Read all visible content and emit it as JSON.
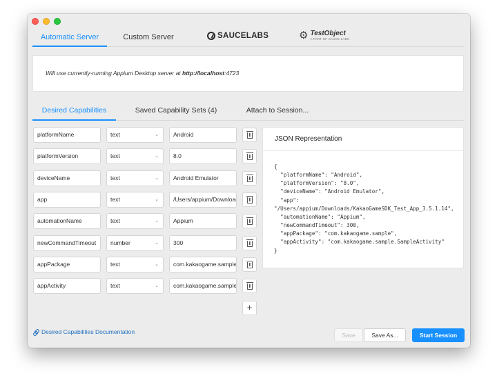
{
  "server_tabs": {
    "automatic": "Automatic Server",
    "custom": "Custom Server",
    "saucelabs": "SAUCELABS",
    "testobject": "TestObject",
    "testobject_sub": "A PART OF SAUCE LABS"
  },
  "server_message": {
    "prefix": "Will use currently-running Appium Desktop server at ",
    "url": "http://localhost",
    "port": ":4723"
  },
  "cap_tabs": {
    "desired": "Desired Capabilities",
    "saved": "Saved Capability Sets (4)",
    "attach": "Attach to Session..."
  },
  "capabilities": [
    {
      "name": "platformName",
      "type": "text",
      "value": "Android"
    },
    {
      "name": "platformVersion",
      "type": "text",
      "value": "8.0"
    },
    {
      "name": "deviceName",
      "type": "text",
      "value": "Android Emulator"
    },
    {
      "name": "app",
      "type": "text",
      "value": "/Users/appium/Downloads/KakaoGameSDK_Test_App_3.5.1.14"
    },
    {
      "name": "automationName",
      "type": "text",
      "value": "Appium"
    },
    {
      "name": "newCommandTimeout",
      "type": "number",
      "value": "300"
    },
    {
      "name": "appPackage",
      "type": "text",
      "value": "com.kakaogame.sample"
    },
    {
      "name": "appActivity",
      "type": "text",
      "value": "com.kakaogame.sample.SampleActivity"
    }
  ],
  "json_panel": {
    "title": "JSON Representation",
    "body": "{\n  \"platformName\": \"Android\",\n  \"platformVersion\": \"8.0\",\n  \"deviceName\": \"Android Emulator\",\n  \"app\":\n\"/Users/appium/Downloads/KakaoGameSDK_Test_App_3.5.1.14\",\n  \"automationName\": \"Appium\",\n  \"newCommandTimeout\": 300,\n  \"appPackage\": \"com.kakaogame.sample\",\n  \"appActivity\": \"com.kakaogame.sample.SampleActivity\"\n}"
  },
  "footer": {
    "docs_link": "Desired Capabilities Documentation",
    "save": "Save",
    "save_as": "Save As...",
    "start": "Start Session"
  },
  "icons": {
    "add": "+",
    "chevron": "⌄"
  },
  "colors": {
    "accent": "#1890ff",
    "window_bg": "#ececec"
  }
}
